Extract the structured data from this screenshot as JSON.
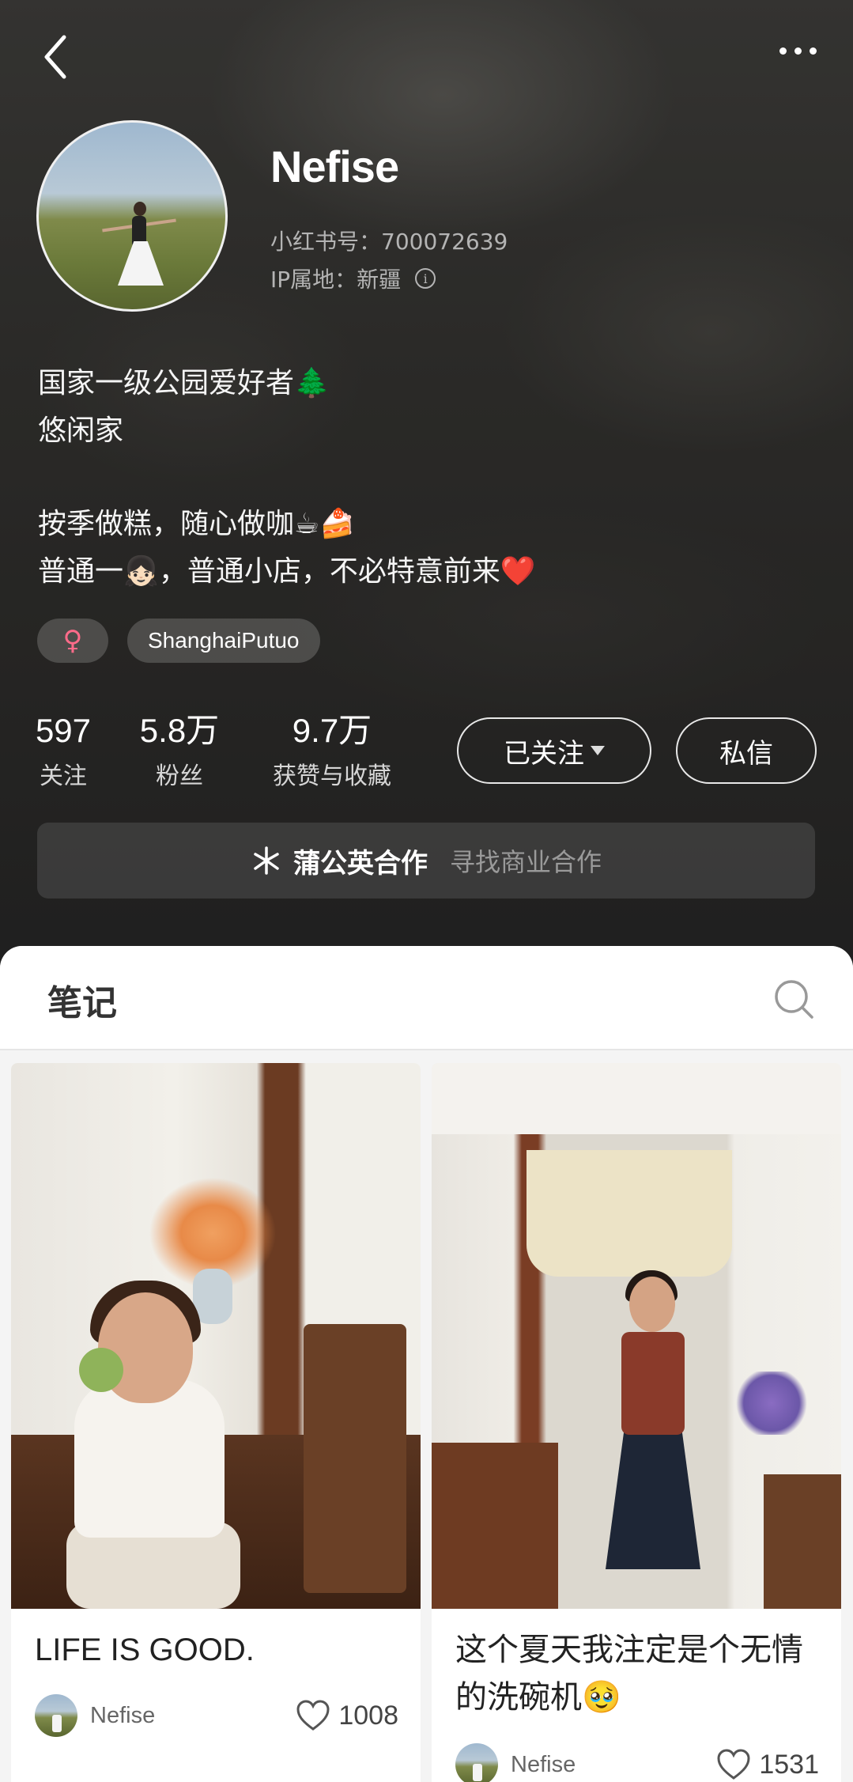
{
  "profile": {
    "name": "Nefise",
    "red_id": "小红书号：700072639",
    "ip_location": "IP属地：新疆",
    "bio_lines": [
      "国家一级公园爱好者🌲",
      "悠闲家",
      "",
      "按季做糕，随心做咖☕🍰",
      "普通一👧🏻，普通小店，不必特意前来❤️"
    ],
    "tags": {
      "gender_symbol": "♀",
      "location": "ShanghaiPutuo"
    },
    "stats": [
      {
        "num": "597",
        "label": "关注"
      },
      {
        "num": "5.8万",
        "label": "粉丝"
      },
      {
        "num": "9.7万",
        "label": "获赞与收藏"
      }
    ],
    "follow_label": "已关注",
    "message_label": "私信",
    "collab_title": "蒲公英合作",
    "collab_sub": "寻找商业合作"
  },
  "tabs": {
    "notes_label": "笔记"
  },
  "notes": [
    {
      "title": "LIFE IS GOOD.",
      "author": "Nefise",
      "likes": "1008"
    },
    {
      "title": "这个夏天我注定是个无情的洗碗机🥹",
      "author": "Nefise",
      "likes": "1531"
    }
  ],
  "colors": {
    "header_bg": "#2a2a2a",
    "sheet_bg": "#f4f4f4",
    "gender_pink": "#ff6b8a"
  },
  "icons": {
    "back": "chevron-left-icon",
    "more": "more-dots-icon",
    "info": "info-icon",
    "dandelion": "dandelion-icon",
    "search": "search-icon",
    "heart": "heart-outline-icon"
  }
}
